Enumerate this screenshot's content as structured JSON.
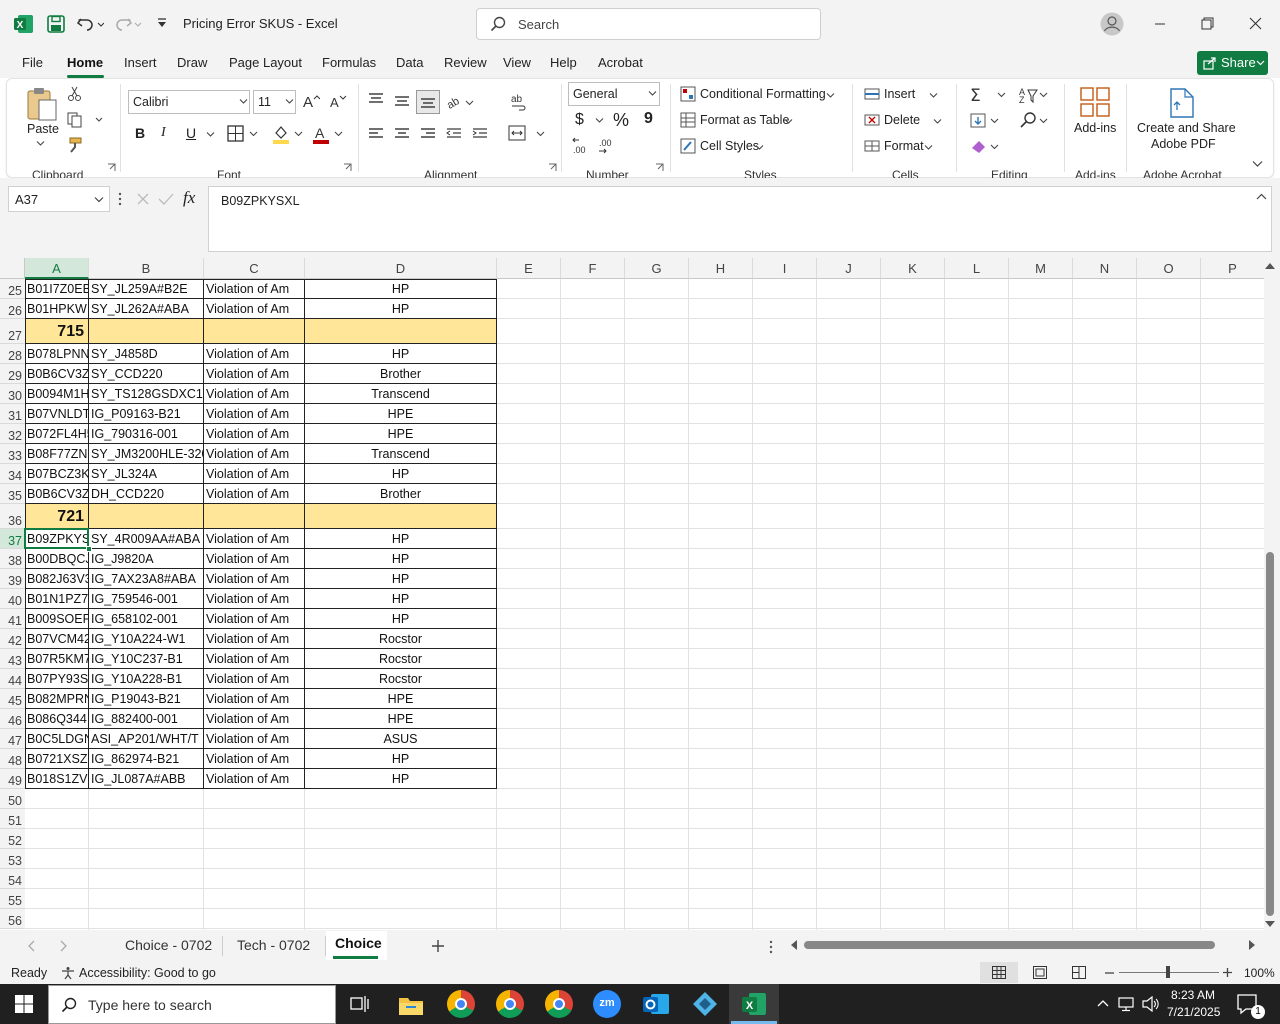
{
  "window": {
    "title": "Pricing Error SKUS  -  Excel",
    "search_placeholder": "Search",
    "icons": [
      "excel-logo-icon",
      "save-icon",
      "undo-icon",
      "redo-icon",
      "customize-icon",
      "account-icon",
      "minimize-icon",
      "restore-icon",
      "close-icon"
    ]
  },
  "ribbon_tabs": [
    "File",
    "Home",
    "Insert",
    "Draw",
    "Page Layout",
    "Formulas",
    "Data",
    "Review",
    "View",
    "Help",
    "Acrobat"
  ],
  "active_tab": "Home",
  "share_label": "Share",
  "clipboard": {
    "paste": "Paste",
    "group": "Clipboard"
  },
  "font": {
    "name": "Calibri",
    "size": "11",
    "group": "Font",
    "bold": "B",
    "italic": "I",
    "underline": "U"
  },
  "alignment": {
    "group": "Alignment"
  },
  "number": {
    "format": "General",
    "currency": "$",
    "percent": "%",
    "comma": "9",
    "group": "Number"
  },
  "styles": {
    "conditional": "Conditional Formatting",
    "table": "Format as Table",
    "cell": "Cell Styles",
    "group": "Styles"
  },
  "cells": {
    "insert": "Insert",
    "delete": "Delete",
    "format": "Format",
    "group": "Cells"
  },
  "editing": {
    "group": "Editing"
  },
  "addins": {
    "label": "Add-ins",
    "group": "Add-ins"
  },
  "acrobat": {
    "label1": "Create and Share",
    "label2": "Adobe PDF",
    "group": "Adobe Acrobat"
  },
  "formula_bar": {
    "name_box": "A37",
    "fx": "fx",
    "formula": "B09ZPKYSXL"
  },
  "columns": [
    "A",
    "B",
    "C",
    "D",
    "E",
    "F",
    "G",
    "H",
    "I",
    "J",
    "K",
    "L",
    "M",
    "N",
    "O",
    "P"
  ],
  "rows": [
    {
      "n": "25",
      "a": "B01I7Z0EB",
      "b": "SY_JL259A#B2E",
      "c": "Violation of Am",
      "d": "HP"
    },
    {
      "n": "26",
      "a": "B01HPKW",
      "b": "SY_JL262A#ABA",
      "c": "Violation of Am",
      "d": "HP"
    },
    {
      "n": "27",
      "a": "715",
      "b": "",
      "c": "",
      "d": ""
    },
    {
      "n": "28",
      "a": "B078LPNN",
      "b": "SY_J4858D",
      "c": "Violation of Am",
      "d": "HP"
    },
    {
      "n": "29",
      "a": "B0B6CV3Z",
      "b": "SY_CCD220",
      "c": "Violation of Am",
      "d": "Brother"
    },
    {
      "n": "30",
      "a": "B0094M1H",
      "b": "SY_TS128GSDXC10",
      "c": "Violation of Am",
      "d": "Transcend"
    },
    {
      "n": "31",
      "a": "B07VNLDT",
      "b": "IG_P09163-B21",
      "c": "Violation of Am",
      "d": "HPE"
    },
    {
      "n": "32",
      "a": "B072FL4H5",
      "b": "IG_790316-001",
      "c": "Violation of Am",
      "d": "HPE"
    },
    {
      "n": "33",
      "a": "B08F77ZN",
      "b": "SY_JM3200HLE-320",
      "c": "Violation of Am",
      "d": "Transcend"
    },
    {
      "n": "34",
      "a": "B07BCZ3K",
      "b": "SY_JL324A",
      "c": "Violation of Am",
      "d": "HP"
    },
    {
      "n": "35",
      "a": "B0B6CV3Z",
      "b": "DH_CCD220",
      "c": "Violation of Am",
      "d": "Brother"
    },
    {
      "n": "36",
      "a": "721",
      "b": "",
      "c": "",
      "d": ""
    },
    {
      "n": "37",
      "a": "B09ZPKYS",
      "b": "SY_4R009AA#ABA",
      "c": "Violation of Am",
      "d": "HP"
    },
    {
      "n": "38",
      "a": "B00DBQCJ",
      "b": "IG_J9820A",
      "c": "Violation of Am",
      "d": "HP"
    },
    {
      "n": "39",
      "a": "B082J63V3",
      "b": "IG_7AX23A8#ABA",
      "c": "Violation of Am",
      "d": "HP"
    },
    {
      "n": "40",
      "a": "B01N1PZ7",
      "b": "IG_759546-001",
      "c": "Violation of Am",
      "d": "HP"
    },
    {
      "n": "41",
      "a": "B009SOEF",
      "b": "IG_658102-001",
      "c": "Violation of Am",
      "d": "HP"
    },
    {
      "n": "42",
      "a": "B07VCM42",
      "b": "IG_Y10A224-W1",
      "c": "Violation of Am",
      "d": "Rocstor"
    },
    {
      "n": "43",
      "a": "B07R5KM7",
      "b": "IG_Y10C237-B1",
      "c": "Violation of Am",
      "d": "Rocstor"
    },
    {
      "n": "44",
      "a": "B07PY93S",
      "b": "IG_Y10A228-B1",
      "c": "Violation of Am",
      "d": "Rocstor"
    },
    {
      "n": "45",
      "a": "B082MPRN",
      "b": "IG_P19043-B21",
      "c": "Violation of Am",
      "d": "HPE"
    },
    {
      "n": "46",
      "a": "B086Q344",
      "b": "IG_882400-001",
      "c": "Violation of Am",
      "d": "HPE"
    },
    {
      "n": "47",
      "a": "B0C5LDGN",
      "b": "ASI_AP201/WHT/T",
      "c": "Violation of Am",
      "d": "ASUS"
    },
    {
      "n": "48",
      "a": "B0721XSZ",
      "b": "IG_862974-B21",
      "c": "Violation of Am",
      "d": "HP"
    },
    {
      "n": "49",
      "a": "B018S1ZV",
      "b": "IG_JL087A#ABB",
      "c": "Violation of Am",
      "d": "HP"
    },
    {
      "n": "50",
      "a": "",
      "b": "",
      "c": "",
      "d": ""
    },
    {
      "n": "51",
      "a": "",
      "b": "",
      "c": "",
      "d": ""
    },
    {
      "n": "52",
      "a": "",
      "b": "",
      "c": "",
      "d": ""
    },
    {
      "n": "53",
      "a": "",
      "b": "",
      "c": "",
      "d": ""
    },
    {
      "n": "54",
      "a": "",
      "b": "",
      "c": "",
      "d": ""
    },
    {
      "n": "55",
      "a": "",
      "b": "",
      "c": "",
      "d": ""
    },
    {
      "n": "56",
      "a": "",
      "b": "",
      "c": "",
      "d": ""
    }
  ],
  "sheets": [
    "Choice - 0702",
    "Tech - 0702",
    "Choice"
  ],
  "active_sheet": "Choice",
  "status": {
    "ready": "Ready",
    "accessibility": "Accessibility: Good to go",
    "zoom": "100%"
  },
  "taskbar": {
    "search_placeholder": "Type here to search",
    "time": "8:23 AM",
    "date": "7/21/2025",
    "notifications": "1"
  },
  "colors": {
    "excel_green": "#107c41",
    "highlight_row": "#ffe699",
    "taskbar": "#202020"
  }
}
